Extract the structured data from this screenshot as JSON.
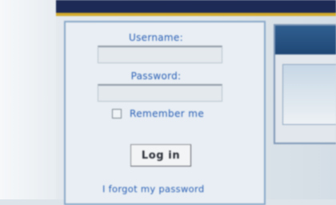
{
  "login": {
    "username_label": "Username:",
    "password_label": "Password:",
    "remember_label": "Remember me",
    "remember_checked": false,
    "login_button": "Log in",
    "forgot_link": "I forgot my password"
  },
  "colors": {
    "banner": "#1d2a55",
    "banner_stripe": "#d3aa2c",
    "link_blue": "#2a5fb5",
    "panel_border": "#8aa8c8",
    "right_panel_header": "#1f4775"
  }
}
